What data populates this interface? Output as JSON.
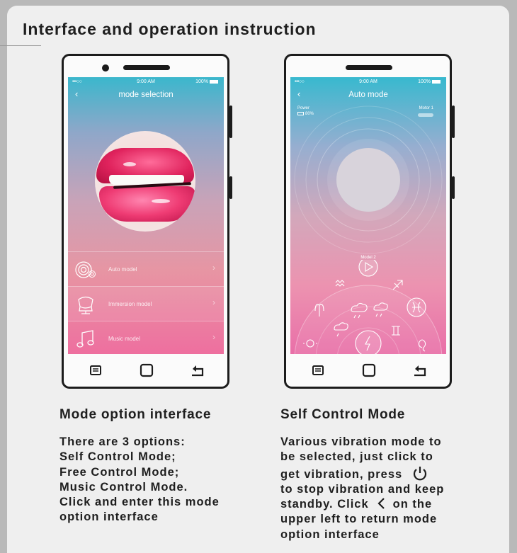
{
  "page": {
    "title": "Interface and operation instruction"
  },
  "phone_left": {
    "status": {
      "signal": "•••○○",
      "time": "9:00 AM",
      "battery": "100%"
    },
    "screen_title": "mode selection",
    "modes": [
      {
        "label": "Auto model",
        "icon": "concentric-circles-icon"
      },
      {
        "label": "Immersion model",
        "icon": "chair-icon"
      },
      {
        "label": "Music model",
        "icon": "music-note-icon"
      }
    ]
  },
  "phone_right": {
    "status": {
      "signal": "•••○○",
      "time": "9:00 AM",
      "battery": "100%"
    },
    "screen_title": "Auto mode",
    "power_label": "Power",
    "power_value": "80%",
    "motor_label": "Motor 1",
    "wheel_label": "Model 2",
    "wheel_icons": [
      "play-icon",
      "aquarius-icon",
      "sagittarius-icon",
      "aries-icon",
      "cloud-rain-icon",
      "cloud-rain-icon",
      "pisces-icon",
      "cloud-rain-icon",
      "gemini-icon",
      "taurus-icon",
      "lightning-icon",
      "leo-icon"
    ]
  },
  "left_column": {
    "title": "Mode option interface",
    "body": "There are 3 options:\nSelf Control Mode;\nFree Control Mode;\nMusic Control Mode.\nClick and enter this mode\noption interface"
  },
  "right_column": {
    "title": "Self Control Mode",
    "line1": "Various vibration mode to",
    "line2": "be selected, just click to",
    "line3": "get vibration, press",
    "line4": "to stop vibration and keep",
    "line5a": "standby. Click",
    "line5b": "on the",
    "line6": "upper left to return mode",
    "line7": "option interface"
  },
  "colors": {
    "accent_pink": "#ee6f9f",
    "accent_teal": "#3bb7cc",
    "text": "#1e1e1e"
  }
}
